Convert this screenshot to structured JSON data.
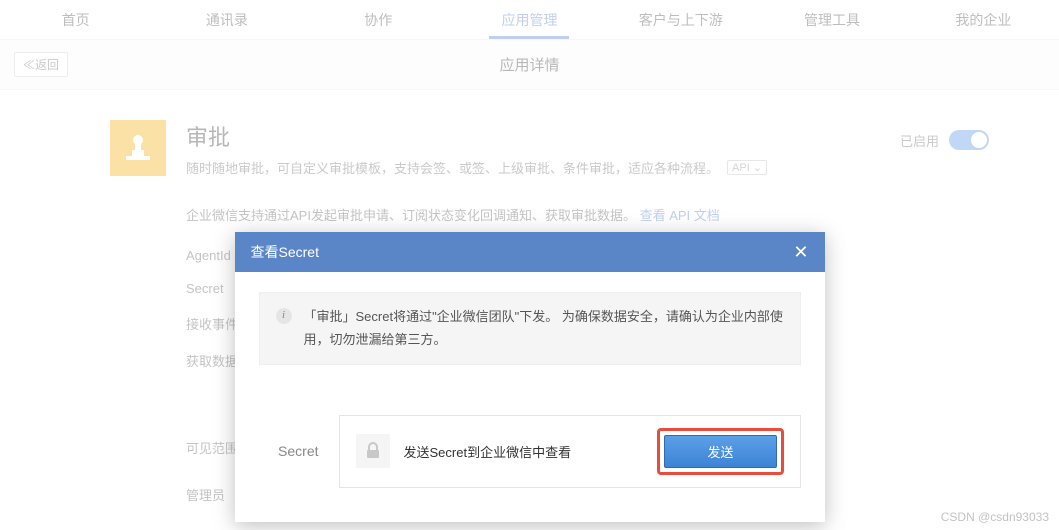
{
  "nav": {
    "items": [
      "首页",
      "通讯录",
      "协作",
      "应用管理",
      "客户与上下游",
      "管理工具",
      "我的企业"
    ],
    "active_index": 3
  },
  "back_button": "≪返回",
  "page_title": "应用详情",
  "app": {
    "name": "审批",
    "desc": "随时随地审批，可自定义审批模板，支持会签、或签、上级审批、条件审批，适应各种流程。",
    "api_badge": "API ⌄",
    "enabled_label": "已启用"
  },
  "meta": {
    "api_note_prefix": "企业微信支持通过API发起审批申请、订阅状态变化回调通知、获取审批数据。",
    "api_link": "查看 API 文档",
    "rows": [
      {
        "key": "AgentId",
        "value": ""
      },
      {
        "key": "Secret",
        "value": ""
      },
      {
        "key": "接收事件",
        "value": ""
      },
      {
        "key": "获取数据",
        "value": ""
      }
    ]
  },
  "sections": {
    "visible_range_label": "可见范围",
    "admin_label": "管理员"
  },
  "modal": {
    "title": "查看Secret",
    "tip": "「审批」Secret将通过\"企业微信团队\"下发。 为确保数据安全，请确认为企业内部使用，切勿泄漏给第三方。",
    "secret_label": "Secret",
    "secret_text": "发送Secret到企业微信中查看",
    "send_button": "发送"
  },
  "watermark": "CSDN @csdn93033"
}
